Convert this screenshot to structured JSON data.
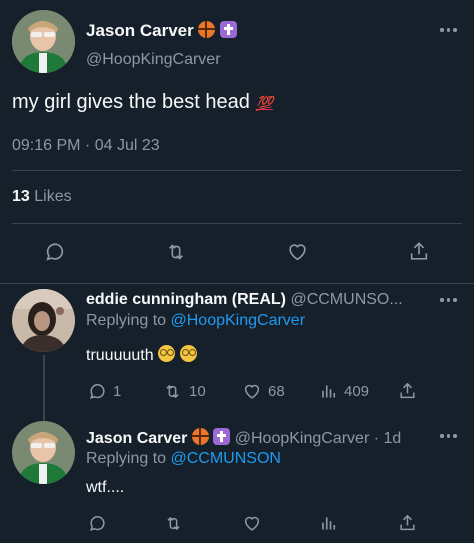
{
  "main_tweet": {
    "display_name": "Jason Carver",
    "handle": "@HoopKingCarver",
    "text": "my girl gives the best head",
    "emoji": "💯",
    "timestamp": "09:16 PM · 04 Jul 23",
    "likes_count": "13",
    "likes_label": "Likes"
  },
  "reply_1": {
    "display_name": "eddie cunningham (REAL)",
    "handle": "@CCMUNSO...",
    "replying_to_label": "Replying to",
    "replying_to_handle": "@HoopKingCarver",
    "text": "truuuuuth",
    "stats": {
      "replies": "1",
      "retweets": "10",
      "likes": "68",
      "views": "409"
    }
  },
  "reply_2": {
    "display_name": "Jason Carver",
    "handle": "@HoopKingCarver",
    "time": "· 1d",
    "replying_to_label": "Replying to",
    "replying_to_handle": "@CCMUNSON",
    "text": "wtf...."
  },
  "colors": {
    "background": "#15202b",
    "muted": "#8b98a5",
    "link": "#1d9bf0",
    "divider": "#38444d"
  }
}
